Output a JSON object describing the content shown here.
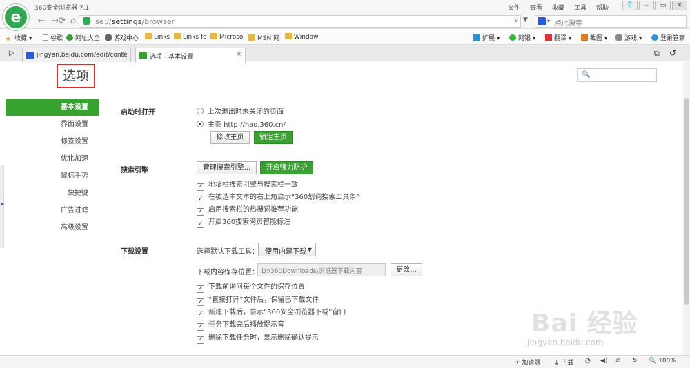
{
  "window": {
    "app_title": "360安全浏览器 7.1",
    "logo_glyph": "e",
    "menu": [
      "文件",
      "查看",
      "收藏",
      "工具",
      "帮助"
    ],
    "win_buttons": [
      "👕",
      "–",
      "▭",
      "✕"
    ]
  },
  "address": {
    "back": "←",
    "forward": "→",
    "refresh": "⟳",
    "home": "⌂",
    "url_scheme": "se://",
    "url_path": "settings",
    "url_rest": "/browser",
    "search_placeholder": "点此搜索"
  },
  "bookmarks": {
    "left": [
      "收藏",
      "谷歌",
      "网址大全",
      "游戏中心",
      "Links",
      "Links fo",
      "Microso",
      "MSN 网",
      "Window"
    ],
    "right": [
      "扩展",
      "网银",
      "翻译",
      "截图",
      "游戏",
      "登录管家"
    ]
  },
  "tabs": [
    {
      "label": "jingyan.baidu.com/edit/conte",
      "close": "×"
    },
    {
      "label": "选项 - 基本设置",
      "close": "×"
    }
  ],
  "page": {
    "heading": "选项",
    "nav": [
      "基本设置",
      "界面设置",
      "标签设置",
      "优化加速",
      "鼠标手势",
      "快捷键",
      "广告过滤",
      "高级设置"
    ],
    "startup": {
      "title": "启动时打开",
      "option1": "上次退出时未关闭的页面",
      "option2": "主页   http://hao.360.cn/",
      "btn_edit": "修改主页",
      "btn_lock": "锁定主页"
    },
    "search": {
      "title": "搜索引擎",
      "btn_manage": "管理搜索引擎...",
      "btn_protect": "开启强力防护",
      "checks": [
        "地址栏搜索引擎与搜索栏一致",
        "在被选中文本的右上角显示“360划词搜索工具条”",
        "启用搜索栏的热搜词推荐功能",
        "开启360搜索网页智能标注"
      ]
    },
    "download": {
      "title": "下载设置",
      "tool_label": "选择默认下载工具：",
      "tool_value": "使用内建下载",
      "path_label": "下载内容保存位置：",
      "path_value": "D:\\360Downloads\\浏览器下载内容",
      "btn_change": "更改...",
      "checks": [
        "下载前询问每个文件的保存位置",
        "“直接打开”文件后，保留已下载文件",
        "新建下载后，显示“360安全浏览器下载”窗口",
        "任务下载完后播放提示音",
        "删除下载任务时，显示删除确认提示"
      ]
    }
  },
  "watermark": {
    "text": "Bai 经验",
    "url": "jingyan.baidu.com"
  },
  "status": {
    "accelerator": "加速器",
    "download": "下载",
    "zoom": "100%"
  },
  "colors": {
    "accent": "#37a22f",
    "highlight_box": "#e32a2a"
  }
}
